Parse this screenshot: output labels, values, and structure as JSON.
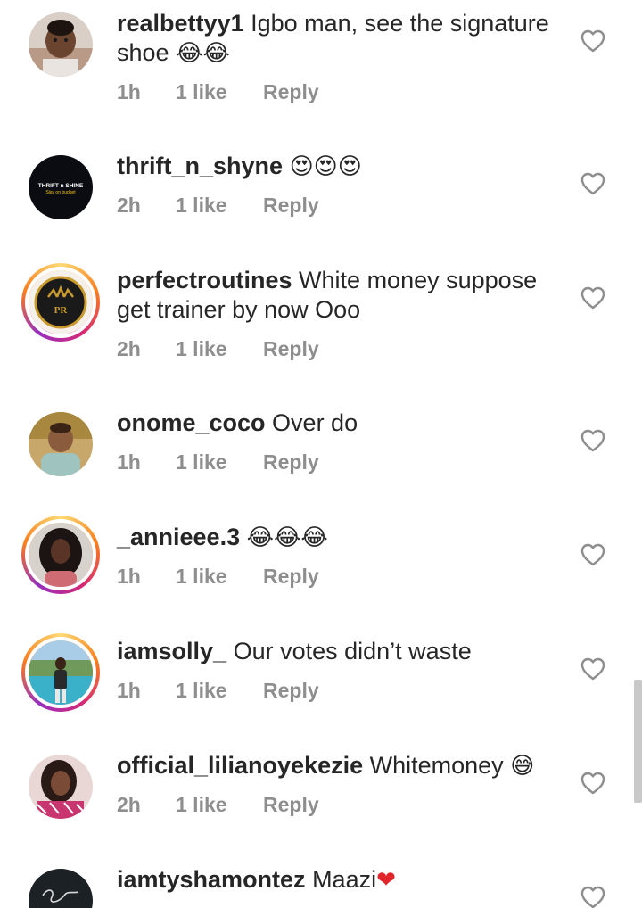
{
  "comments": [
    {
      "username": "realbettyy1",
      "text": " Igbo man, see the signature shoe ",
      "emoji": "😂😂",
      "time": "1h",
      "likes": "1 like",
      "reply": "Reply",
      "avatar_icon": "child-photo-avatar",
      "story_ring": false
    },
    {
      "username": "thrift_n_shyne",
      "text": " ",
      "emoji": "😍😍😍",
      "time": "2h",
      "likes": "1 like",
      "reply": "Reply",
      "avatar_icon": "thrift-n-shine-logo-avatar",
      "avatar_logo_text": "THRIFT n SHINE",
      "avatar_logo_sub": "Slay on budget",
      "story_ring": false
    },
    {
      "username": "perfectroutines",
      "text": " White money suppose get trainer by now Ooo",
      "emoji": "",
      "time": "2h",
      "likes": "1 like",
      "reply": "Reply",
      "avatar_icon": "perfect-routines-logo-avatar",
      "avatar_logo_text": "PR",
      "story_ring": true
    },
    {
      "username": "onome_coco",
      "text": " Over do",
      "emoji": "",
      "time": "1h",
      "likes": "1 like",
      "reply": "Reply",
      "avatar_icon": "baby-photo-avatar",
      "story_ring": false
    },
    {
      "username": "_annieee.3",
      "text": " ",
      "emoji": "😂😂😂",
      "time": "1h",
      "likes": "1 like",
      "reply": "Reply",
      "avatar_icon": "woman-photo-avatar",
      "story_ring": true
    },
    {
      "username": "iamsolly_",
      "text": " Our votes didn’t waste",
      "emoji": "",
      "time": "1h",
      "likes": "1 like",
      "reply": "Reply",
      "avatar_icon": "man-poolside-photo-avatar",
      "story_ring": true
    },
    {
      "username": "official_lilianoyekezie",
      "text": " Whitemoney ",
      "emoji": "😅",
      "time": "2h",
      "likes": "1 like",
      "reply": "Reply",
      "avatar_icon": "woman-selfie-photo-avatar",
      "story_ring": false
    },
    {
      "username": "iamtyshamontez",
      "text": " Maazi",
      "emoji": "❤",
      "time": "",
      "likes": "",
      "reply": "",
      "avatar_icon": "signature-logo-avatar",
      "story_ring": false
    }
  ],
  "colors": {
    "text": "#262626",
    "meta": "#8e8e8e",
    "heart_outline": "#8e8e8e",
    "red_heart": "#e0262b"
  }
}
